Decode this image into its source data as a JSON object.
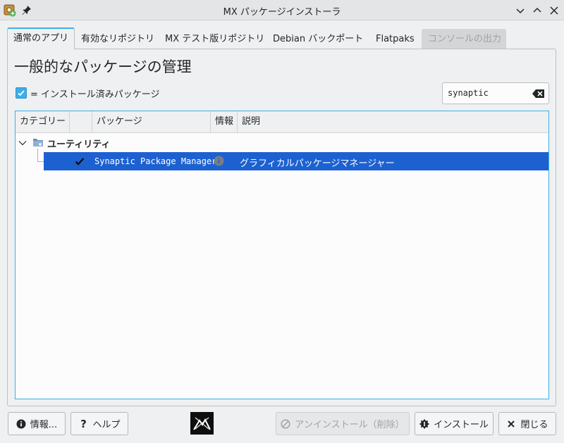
{
  "window": {
    "title": "MX パッケージインストーラ"
  },
  "tabs": [
    {
      "label": "通常のアプリ",
      "state": "active"
    },
    {
      "label": "有効なリポジトリ",
      "state": "normal"
    },
    {
      "label": "MX テスト版リポジトリ",
      "state": "normal"
    },
    {
      "label": "Debian バックポート",
      "state": "normal"
    },
    {
      "label": "Flatpaks",
      "state": "normal"
    },
    {
      "label": "コンソールの出力",
      "state": "disabled"
    }
  ],
  "main": {
    "heading": "一般的なパッケージの管理",
    "installed_legend": "= インストール済みパッケージ",
    "installed_checked": true,
    "search": {
      "value": "synaptic"
    }
  },
  "tree": {
    "columns": [
      "カテゴリー",
      "",
      "パッケージ",
      "情報",
      "説明"
    ],
    "groups": [
      {
        "name": "ユーティリティ",
        "expanded": true,
        "rows": [
          {
            "installed": true,
            "package": "Synaptic Package Manager",
            "info_icon": "info-icon",
            "description": "グラフィカルパッケージマネージャー",
            "selected": true
          }
        ]
      }
    ]
  },
  "buttons": {
    "about": "情報...",
    "help": "ヘルプ",
    "uninstall": "アンインストール（削除）",
    "install": "インストール",
    "close": "閉じる"
  },
  "colors": {
    "accent": "#3daee9",
    "selection": "#1d61d1",
    "window_bg": "#eff0f1"
  }
}
